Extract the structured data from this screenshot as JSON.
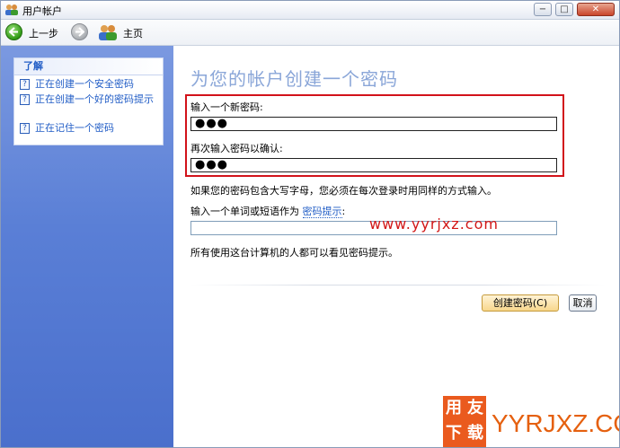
{
  "window": {
    "title": "用户帐户",
    "controls": {
      "minimize": "−",
      "maximize": "□",
      "close": "✕"
    }
  },
  "toolbar": {
    "back_label": "上一步",
    "home_label": "主页"
  },
  "sidebar": {
    "header": "了解",
    "items": [
      {
        "label": "正在创建一个安全密码"
      },
      {
        "label": "正在创建一个好的密码提示"
      },
      {
        "label": "正在记住一个密码"
      }
    ]
  },
  "main": {
    "heading": "为您的帐户创建一个密码",
    "new_password_label": "输入一个新密码:",
    "new_password_value": "●●●",
    "confirm_password_label": "再次输入密码以确认:",
    "confirm_password_value": "●●●",
    "case_note": "如果您的密码包含大写字母，您必须在每次登录时用同样的方式输入。",
    "hint_prompt": "输入一个单词或短语作为",
    "hint_link": "密码提示",
    "hint_colon": ":",
    "hint_value": "",
    "hint_visibility_note": "所有使用这台计算机的人都可以看见密码提示。",
    "create_button": "创建密码(C)",
    "cancel_button": "取消"
  },
  "watermarks": {
    "site_url": "www.yyrjxz.com",
    "logo_chars": [
      "用",
      "友",
      "下",
      "载"
    ],
    "logo_domain": "YYRJXZ.COM"
  },
  "colors": {
    "sidebar_gradient_top": "#7b99e0",
    "sidebar_gradient_bottom": "#4a6fcc",
    "heading_color": "#8aa6d8",
    "link_color": "#215dc6",
    "highlight_box": "#d2121a",
    "watermark_orange": "#e5600f"
  }
}
